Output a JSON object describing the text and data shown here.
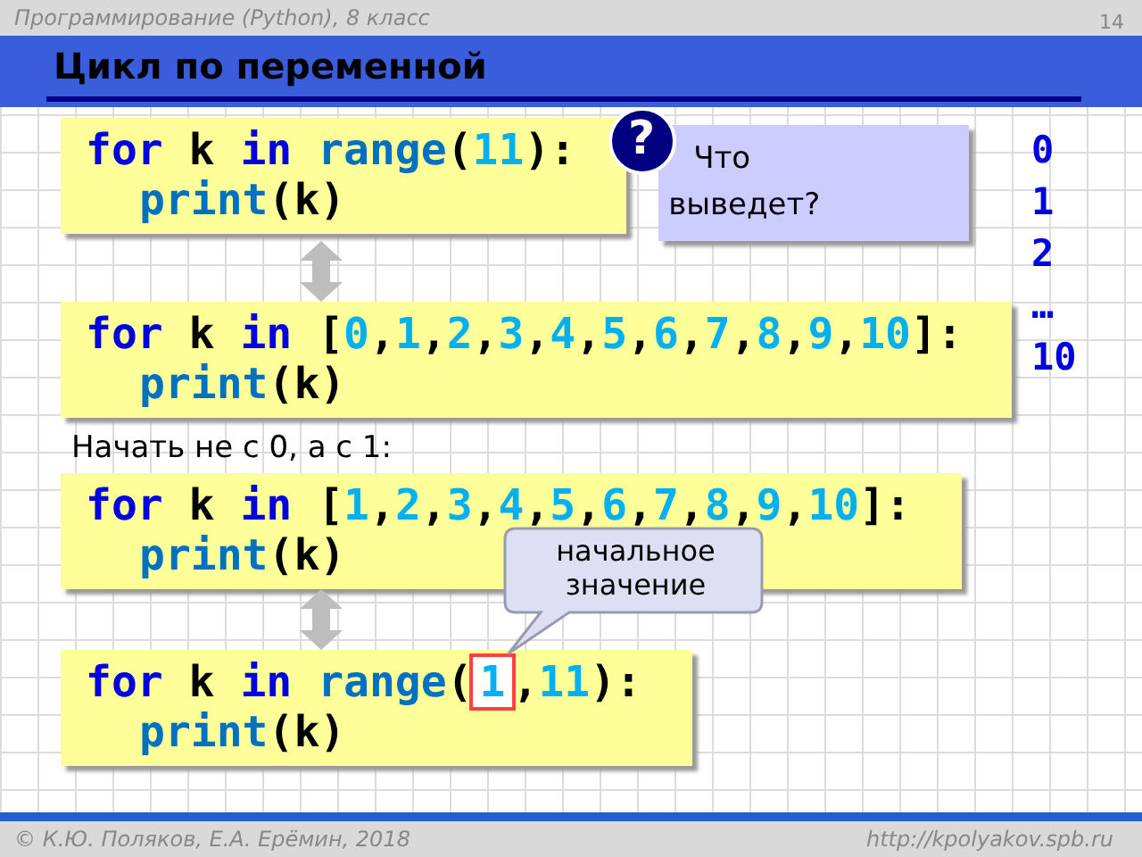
{
  "header": {
    "course": "Программирование (Python), 8 класс",
    "page": "14"
  },
  "title": "Цикл по переменной",
  "question": {
    "mark": "?",
    "text": "Что выведет?"
  },
  "output": [
    "0",
    "1",
    "2",
    "…",
    "10"
  ],
  "items": [
    {
      "kind": "code",
      "lines": [
        {
          "indent": false,
          "tokens": [
            {
              "kind": "kw",
              "t": "for"
            },
            {
              "kind": "txt",
              "t": " k "
            },
            {
              "kind": "kw",
              "t": "in"
            },
            {
              "kind": "fn",
              "t": " range"
            },
            {
              "kind": "txt",
              "t": "("
            },
            {
              "kind": "num",
              "t": "11"
            },
            {
              "kind": "txt",
              "t": "):"
            }
          ]
        },
        {
          "indent": true,
          "tokens": [
            {
              "kind": "fn",
              "t": "print"
            },
            {
              "kind": "txt",
              "t": "(k)"
            }
          ]
        }
      ]
    },
    {
      "kind": "arrow"
    },
    {
      "kind": "code",
      "lines": [
        {
          "indent": false,
          "tokens": [
            {
              "kind": "kw",
              "t": "for"
            },
            {
              "kind": "txt",
              "t": " k "
            },
            {
              "kind": "kw",
              "t": "in"
            },
            {
              "kind": "txt",
              "t": " ["
            },
            {
              "kind": "num",
              "t": "0"
            },
            {
              "kind": "txt",
              "t": ","
            },
            {
              "kind": "num",
              "t": "1"
            },
            {
              "kind": "txt",
              "t": ","
            },
            {
              "kind": "num",
              "t": "2"
            },
            {
              "kind": "txt",
              "t": ","
            },
            {
              "kind": "num",
              "t": "3"
            },
            {
              "kind": "txt",
              "t": ","
            },
            {
              "kind": "num",
              "t": "4"
            },
            {
              "kind": "txt",
              "t": ","
            },
            {
              "kind": "num",
              "t": "5"
            },
            {
              "kind": "txt",
              "t": ","
            },
            {
              "kind": "num",
              "t": "6"
            },
            {
              "kind": "txt",
              "t": ","
            },
            {
              "kind": "num",
              "t": "7"
            },
            {
              "kind": "txt",
              "t": ","
            },
            {
              "kind": "num",
              "t": "8"
            },
            {
              "kind": "txt",
              "t": ","
            },
            {
              "kind": "num",
              "t": "9"
            },
            {
              "kind": "txt",
              "t": ","
            },
            {
              "kind": "num",
              "t": "10"
            },
            {
              "kind": "txt",
              "t": "]:"
            }
          ]
        },
        {
          "indent": true,
          "tokens": [
            {
              "kind": "fn",
              "t": "print"
            },
            {
              "kind": "txt",
              "t": "(k)"
            }
          ]
        }
      ]
    },
    {
      "kind": "note",
      "text": "Начать не с 0, а с 1:"
    },
    {
      "kind": "code",
      "lines": [
        {
          "indent": false,
          "tokens": [
            {
              "kind": "kw",
              "t": "for"
            },
            {
              "kind": "txt",
              "t": " k "
            },
            {
              "kind": "kw",
              "t": "in"
            },
            {
              "kind": "txt",
              "t": " ["
            },
            {
              "kind": "num",
              "t": "1"
            },
            {
              "kind": "txt",
              "t": ","
            },
            {
              "kind": "num",
              "t": "2"
            },
            {
              "kind": "txt",
              "t": ","
            },
            {
              "kind": "num",
              "t": "3"
            },
            {
              "kind": "txt",
              "t": ","
            },
            {
              "kind": "num",
              "t": "4"
            },
            {
              "kind": "txt",
              "t": ","
            },
            {
              "kind": "num",
              "t": "5"
            },
            {
              "kind": "txt",
              "t": ","
            },
            {
              "kind": "num",
              "t": "6"
            },
            {
              "kind": "txt",
              "t": ","
            },
            {
              "kind": "num",
              "t": "7"
            },
            {
              "kind": "txt",
              "t": ","
            },
            {
              "kind": "num",
              "t": "8"
            },
            {
              "kind": "txt",
              "t": ","
            },
            {
              "kind": "num",
              "t": "9"
            },
            {
              "kind": "txt",
              "t": ","
            },
            {
              "kind": "num",
              "t": "10"
            },
            {
              "kind": "txt",
              "t": "]:"
            }
          ]
        },
        {
          "indent": true,
          "tokens": [
            {
              "kind": "fn",
              "t": "print"
            },
            {
              "kind": "txt",
              "t": "(k)"
            }
          ]
        }
      ]
    },
    {
      "kind": "arrow"
    },
    {
      "kind": "code",
      "lines": [
        {
          "indent": false,
          "tokens": [
            {
              "kind": "kw",
              "t": "for"
            },
            {
              "kind": "txt",
              "t": " k "
            },
            {
              "kind": "kw",
              "t": "in"
            },
            {
              "kind": "fn",
              "t": " range"
            },
            {
              "kind": "txt",
              "t": "("
            },
            {
              "kind": "num",
              "t": "1",
              "callout": "начальное значение"
            },
            {
              "kind": "txt",
              "t": ","
            },
            {
              "kind": "num",
              "t": "11"
            },
            {
              "kind": "txt",
              "t": "):"
            }
          ]
        },
        {
          "indent": true,
          "tokens": [
            {
              "kind": "fn",
              "t": "print"
            },
            {
              "kind": "txt",
              "t": "(k)"
            }
          ]
        }
      ]
    }
  ],
  "footer": {
    "copyright": "© К.Ю. Поляков, Е.А. Ерёмин, 2018",
    "url": "http://kpolyakov.spb.ru"
  }
}
